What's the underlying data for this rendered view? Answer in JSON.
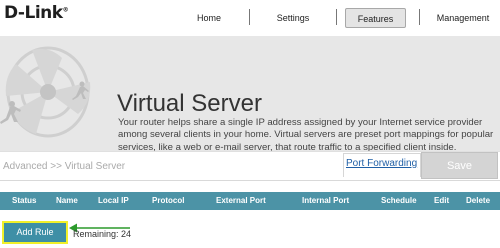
{
  "brand": {
    "name": "D-Link",
    "mark": "®"
  },
  "nav": {
    "items": [
      {
        "label": "Home"
      },
      {
        "label": "Settings"
      },
      {
        "label": "Features"
      },
      {
        "label": "Management"
      }
    ],
    "active": "Features"
  },
  "banner": {
    "title": "Virtual Server",
    "description": "Your router helps share a single IP address assigned by your Internet service provider among several clients in your home. Virtual servers are preset port mappings for popular services, like a web or e-mail server, that route traffic to a specified client inside."
  },
  "breadcrumb": {
    "text": "Advanced >> Virtual Server"
  },
  "actions": {
    "port_forwarding_label": "Port Forwarding",
    "save_label": "Save"
  },
  "table": {
    "columns": [
      "Status",
      "Name",
      "Local IP",
      "Protocol",
      "External Port",
      "Internal Port",
      "Schedule",
      "Edit",
      "Delete"
    ],
    "rows": []
  },
  "footer": {
    "add_rule_label": "Add Rule",
    "remaining_label": "Remaining: 24"
  },
  "colors": {
    "table_header": "#4c93a6",
    "add_rule_bg": "#3e8fa6",
    "highlight_border": "#f0f02a",
    "arrow": "#2c9a2c",
    "link": "#1f5fa6"
  }
}
